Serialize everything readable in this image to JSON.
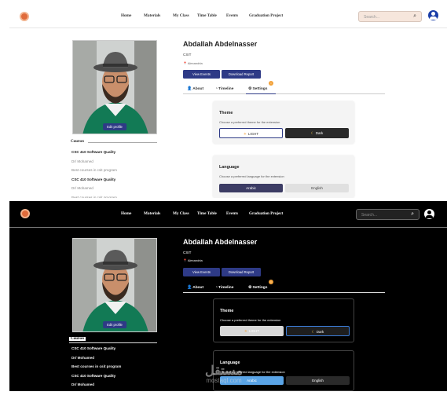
{
  "nav": {
    "items": [
      "Home",
      "Materials",
      "My Class",
      "Time Table",
      "Events",
      "Graduation Project"
    ],
    "search_placeholder": "Search..."
  },
  "profile": {
    "name": "Abdallah Abdelnasser",
    "department": "CSIT",
    "location": "Alexandria",
    "view_events": "View Events",
    "download_report": "Download Report",
    "edit_profile": "Edit profile"
  },
  "tabs": {
    "about": "About",
    "timeline": "Timeline",
    "settings": "Settings"
  },
  "courses": {
    "title": "Courses",
    "light_items": [
      {
        "text": "CSC 410 Software Quality",
        "style": "title"
      },
      {
        "text": "Dr/ Mohamed",
        "style": "sub"
      },
      {
        "text": "Best courses in csit program",
        "style": "sub"
      },
      {
        "text": "CSC 410 Software Quality",
        "style": "title"
      },
      {
        "text": "Dr/ Mohamed",
        "style": "sub"
      },
      {
        "text": "Best courses in csit program",
        "style": "sub"
      }
    ],
    "dark_items": [
      {
        "text": "CSC 410 Software Quality",
        "style": "title"
      },
      {
        "text": "Dr/ Mohamed",
        "style": "sub"
      },
      {
        "text": "Best courses in csit program",
        "style": "sub"
      },
      {
        "text": "CSC 410 Software Quality",
        "style": "title"
      },
      {
        "text": "Dr/ Mohamed",
        "style": "sub"
      }
    ]
  },
  "settings": {
    "theme_title": "Theme",
    "theme_desc": "Choose a preferred theme for the extension",
    "light_label": "LIGHT",
    "dark_label": "Dark",
    "language_title": "Language",
    "language_desc": "Choose a preferred language for the extension",
    "arabic_label": "Arabic",
    "english_label": "English"
  },
  "watermark": {
    "arabic": "مستقل",
    "latin": "mostaql.com"
  },
  "colors": {
    "primary": "#2e3a86",
    "accent": "#f2a23a",
    "dark_selected": "#5aa4e6"
  }
}
